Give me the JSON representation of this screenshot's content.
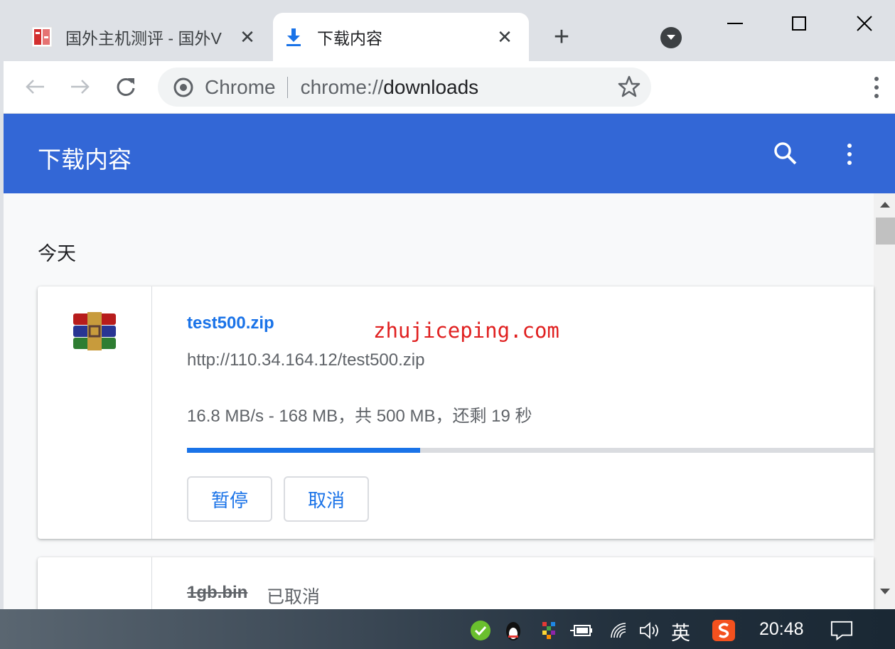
{
  "browser": {
    "tabs": [
      {
        "title": "国外主机测评 - 国外V",
        "favicon": "site-favicon",
        "active": false
      },
      {
        "title": "下载内容",
        "favicon": "download-icon",
        "active": true
      }
    ],
    "new_tab": "+",
    "omnibox": {
      "chip": "Chrome",
      "url_scheme": "chrome://",
      "url_path": "downloads"
    }
  },
  "downloads_page": {
    "title": "下载内容",
    "section_date": "今天",
    "items": [
      {
        "file_name": "test500.zip",
        "url": "http://110.34.164.12/test500.zip",
        "status": "16.8 MB/s - 168 MB，共 500 MB，还剩 19 秒",
        "progress": 0.34,
        "buttons": {
          "pause": "暂停",
          "cancel": "取消"
        },
        "icon": "winrar-archive-icon"
      },
      {
        "file_name": "1gb.bin",
        "state": "已取消"
      }
    ],
    "watermark": "zhujiceping.com"
  },
  "taskbar": {
    "ime": "英",
    "time": "20:48"
  },
  "colors": {
    "header_blue": "#3367d6",
    "link_blue": "#1a73e8",
    "watermark_red": "#e02020"
  }
}
